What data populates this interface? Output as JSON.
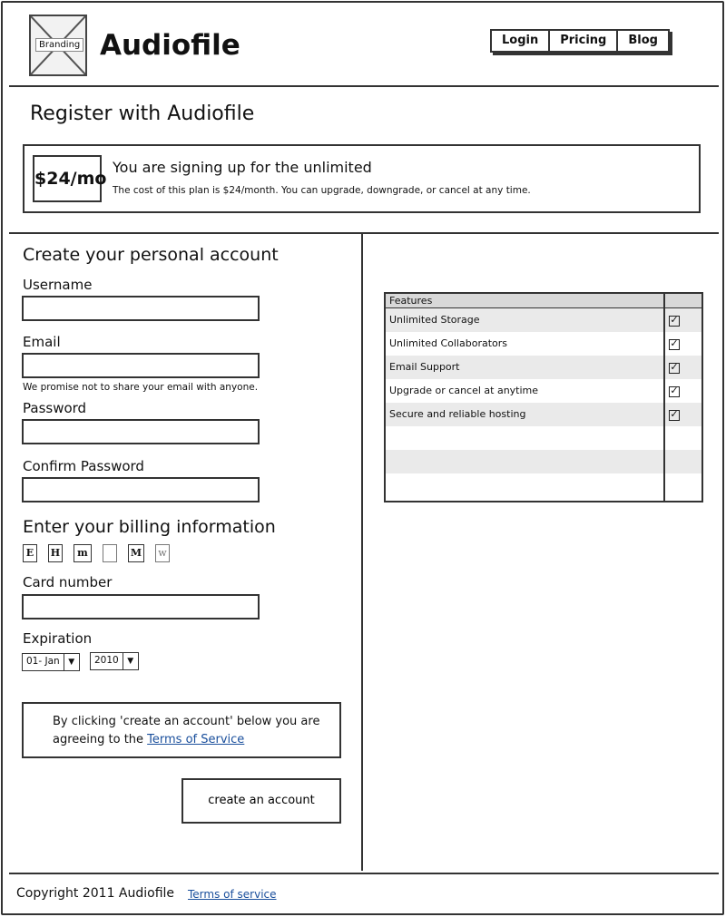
{
  "header": {
    "branding_label": "Branding",
    "app_title": "Audiofile",
    "nav": [
      "Login",
      "Pricing",
      "Blog"
    ]
  },
  "page_title": "Register with Audiofile",
  "plan": {
    "price": "$24/mo",
    "heading": "You are signing up for the unlimited",
    "description": "The cost of this plan is $24/month. You can upgrade, downgrade, or cancel at any time."
  },
  "account": {
    "title": "Create your personal account",
    "username_label": "Username",
    "username_value": "",
    "email_label": "Email",
    "email_value": "",
    "email_note": "We promise not to share your email with anyone.",
    "password_label": "Password",
    "confirm_password_label": "Confirm Password"
  },
  "billing": {
    "title": "Enter your billing information",
    "card_icons": [
      {
        "glyph": "E",
        "icon": "card-icon-e"
      },
      {
        "glyph": "H",
        "icon": "card-icon-h"
      },
      {
        "glyph": "m",
        "icon": "card-icon-m"
      },
      {
        "glyph": "",
        "icon": "document-icon"
      },
      {
        "glyph": "M",
        "icon": "card-icon-M"
      },
      {
        "glyph": "w",
        "icon": "card-icon-w"
      }
    ],
    "card_number_label": "Card number",
    "expiration_label": "Expiration",
    "exp_month": "01- Jan",
    "exp_year": "2010"
  },
  "tos": {
    "text": "By clicking 'create an account' below you are agreeing to the ",
    "link": "Terms of Service"
  },
  "create_button": "create an account",
  "features": {
    "header": "Features",
    "rows": [
      {
        "label": "Unlimited Storage",
        "checked": true
      },
      {
        "label": "Unlimited Collaborators",
        "checked": true
      },
      {
        "label": "Email Support",
        "checked": true
      },
      {
        "label": "Upgrade or cancel at anytime",
        "checked": true
      },
      {
        "label": "Secure and reliable hosting",
        "checked": true
      },
      {
        "label": "",
        "checked": false
      },
      {
        "label": "",
        "checked": false
      },
      {
        "label": "",
        "checked": false
      }
    ]
  },
  "footer": {
    "copyright": "Copyright 2011 Audiofile",
    "link": "Terms of service"
  }
}
